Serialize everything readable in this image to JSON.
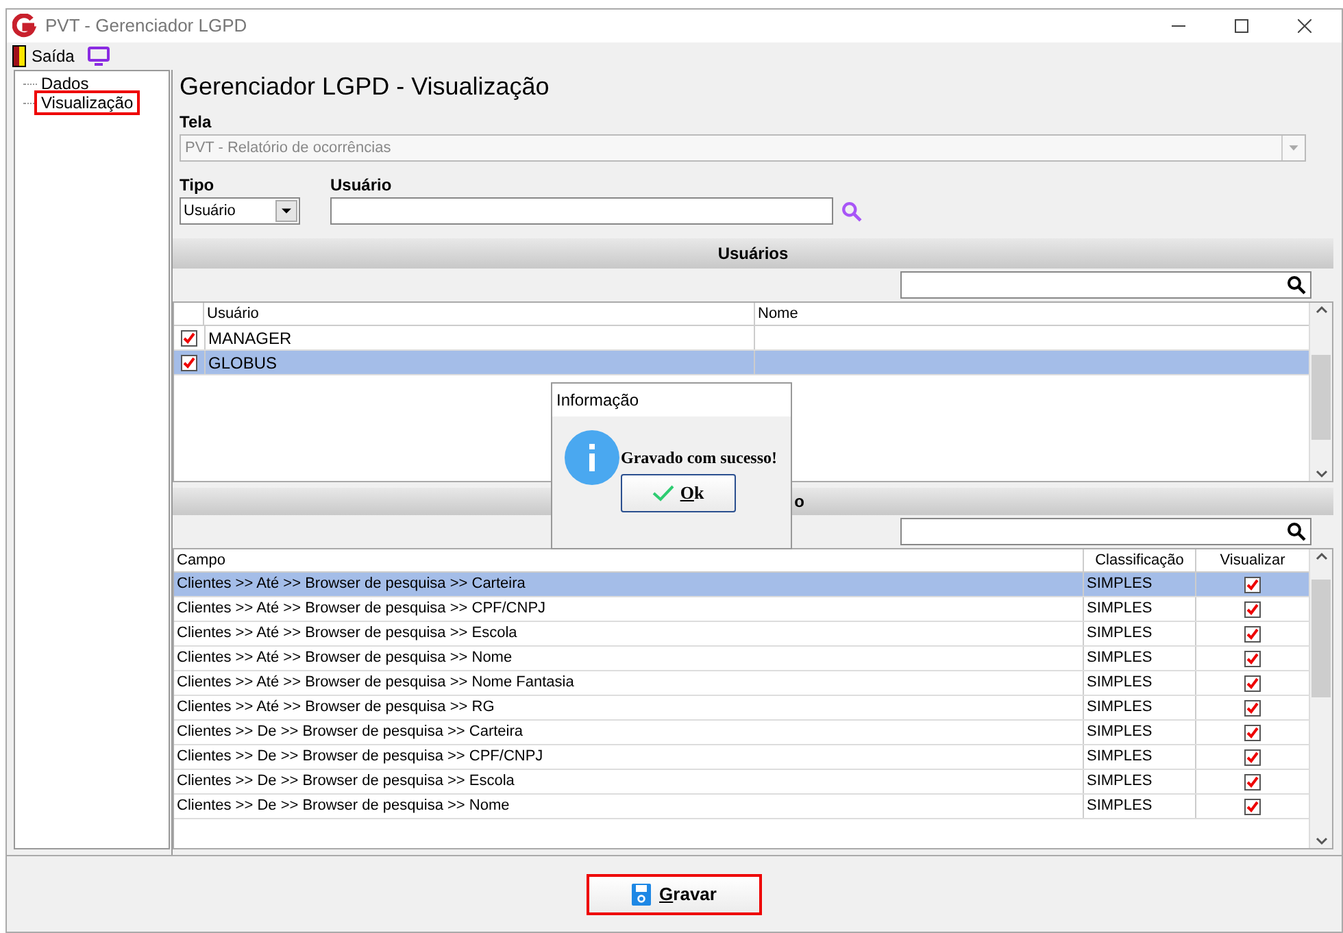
{
  "window": {
    "title": "PVT - Gerenciador LGPD"
  },
  "toolbar": {
    "exit_label": "Saída"
  },
  "tree": {
    "items": [
      {
        "label": "Dados",
        "selected": false
      },
      {
        "label": "Visualização",
        "selected": true
      }
    ]
  },
  "heading": "Gerenciador LGPD - Visualização",
  "tela": {
    "label": "Tela",
    "value": "PVT - Relatório de ocorrências"
  },
  "tipo": {
    "label": "Tipo",
    "value": "Usuário"
  },
  "usuario": {
    "label": "Usuário"
  },
  "users_section": {
    "title": "Usuários",
    "columns": [
      "Usuário",
      "Nome"
    ],
    "rows": [
      {
        "checked": true,
        "user": "MANAGER",
        "selected": false
      },
      {
        "checked": true,
        "user": "GLOBUS",
        "selected": true
      }
    ]
  },
  "fields_section": {
    "title_visible": "o",
    "columns": [
      "Campo",
      "Classificação",
      "Visualizar"
    ],
    "rows": [
      {
        "campo": "Clientes >> Até >> Browser de pesquisa >> Carteira",
        "class": "SIMPLES",
        "checked": true,
        "selected": true
      },
      {
        "campo": "Clientes >> Até >> Browser de pesquisa >> CPF/CNPJ",
        "class": "SIMPLES",
        "checked": true,
        "selected": false
      },
      {
        "campo": "Clientes >> Até >> Browser de pesquisa >> Escola",
        "class": "SIMPLES",
        "checked": true,
        "selected": false
      },
      {
        "campo": "Clientes >> Até >> Browser de pesquisa >> Nome",
        "class": "SIMPLES",
        "checked": true,
        "selected": false
      },
      {
        "campo": "Clientes >> Até >> Browser de pesquisa >> Nome Fantasia",
        "class": "SIMPLES",
        "checked": true,
        "selected": false
      },
      {
        "campo": "Clientes >> Até >> Browser de pesquisa >> RG",
        "class": "SIMPLES",
        "checked": true,
        "selected": false
      },
      {
        "campo": "Clientes >> De >> Browser de pesquisa >> Carteira",
        "class": "SIMPLES",
        "checked": true,
        "selected": false
      },
      {
        "campo": "Clientes >> De >> Browser de pesquisa >> CPF/CNPJ",
        "class": "SIMPLES",
        "checked": true,
        "selected": false
      },
      {
        "campo": "Clientes >> De >> Browser de pesquisa >> Escola",
        "class": "SIMPLES",
        "checked": true,
        "selected": false
      },
      {
        "campo": "Clientes >> De >> Browser de pesquisa >> Nome",
        "class": "SIMPLES",
        "checked": true,
        "selected": false
      }
    ]
  },
  "dialog": {
    "title": "Informação",
    "message": "Gravado com sucesso!",
    "button": "Ok"
  },
  "save_button": "Gravar"
}
